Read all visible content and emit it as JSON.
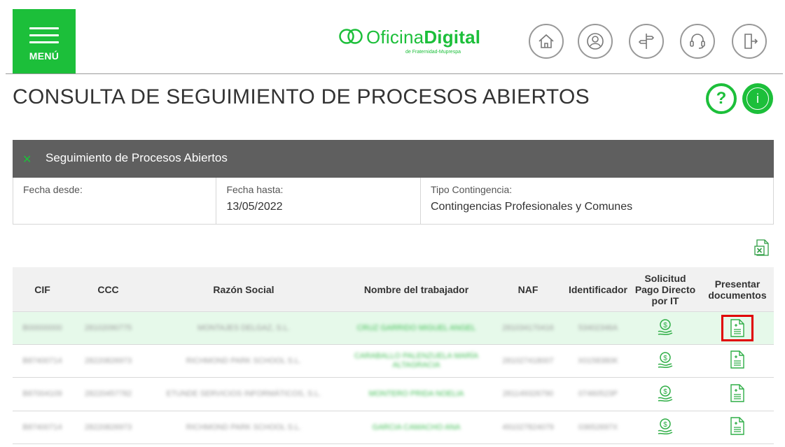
{
  "header": {
    "menu_label": "MENÚ",
    "logo_main_a": "Oficina",
    "logo_main_b": "Digital",
    "logo_sub": "de Fraternidad-Muprespa",
    "icons": [
      "home-icon",
      "user-icon",
      "signpost-icon",
      "headset-icon",
      "logout-icon"
    ]
  },
  "page": {
    "title": "CONSULTA DE SEGUIMIENTO DE PROCESOS ABIERTOS",
    "help_symbol": "?",
    "info_symbol": "i"
  },
  "panel": {
    "close_symbol": "✕",
    "title": "Seguimiento de Procesos Abiertos",
    "filters": [
      {
        "label": "Fecha desde:",
        "value": ""
      },
      {
        "label": "Fecha hasta:",
        "value": "13/05/2022"
      },
      {
        "label": "Tipo Contingencia:",
        "value": "Contingencias Profesionales y Comunes"
      }
    ]
  },
  "table": {
    "headers": {
      "cif": "CIF",
      "ccc": "CCC",
      "razon": "Razón Social",
      "nombre": "Nombre del trabajador",
      "naf": "NAF",
      "identificador": "Identificador",
      "solicitud_l1": "Solicitud",
      "solicitud_l2": "Pago Directo",
      "solicitud_l3": "por IT",
      "presentar_l1": "Presentar",
      "presentar_l2": "documentos"
    },
    "rows": [
      {
        "cif": "B00000000",
        "ccc": "28102090775",
        "razon": "MONTAJES DELGAZ, S.L.",
        "nombre": "CRUZ GARRIDO MIGUEL ANGEL",
        "naf": "281034170416",
        "identificador": "53402346A"
      },
      {
        "cif": "B87400714",
        "ccc": "28220826973",
        "razon": "RICHMOND PARK SCHOOL S.L.",
        "nombre": "CARABALLO PALENZUELA MARÍA ALTAGRACIA",
        "naf": "281027418007",
        "identificador": "X0158380K"
      },
      {
        "cif": "B87004109",
        "ccc": "28220457782",
        "razon": "ETUNDE SERVICIOS INFORMÁTICOS, S.L.",
        "nombre": "MONTERO PRIDA NOELIA",
        "naf": "281149326790",
        "identificador": "07460523P"
      },
      {
        "cif": "B87400714",
        "ccc": "28220826973",
        "razon": "RICHMOND PARK SCHOOL S.L.",
        "nombre": "GARCIA CAMACHO ANA",
        "naf": "491027824079",
        "identificador": "03652697X"
      }
    ],
    "selected_row": 0
  },
  "colors": {
    "brand": "#1cbf3a",
    "panel_header": "#5f5f5f",
    "highlight_row": "#e6f9ea",
    "selection": "#e00000"
  }
}
